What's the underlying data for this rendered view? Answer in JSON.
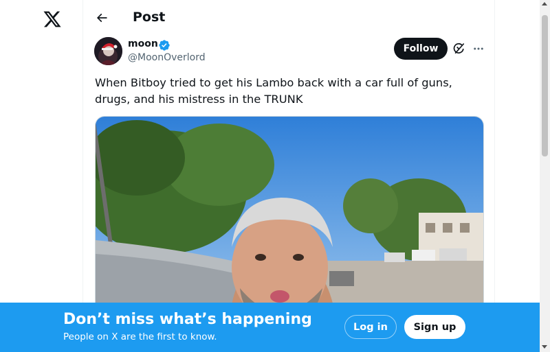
{
  "nav": {
    "logo_icon": "x-logo-icon"
  },
  "header": {
    "back_icon": "arrow-left-icon",
    "title": "Post"
  },
  "post": {
    "author": {
      "name": "moon",
      "handle": "@MoonOverlord",
      "verified": true,
      "verified_color": "#1d9bf0",
      "avatar_icon": "avatar-image"
    },
    "follow_label": "Follow",
    "grok_icon": "grok-icon",
    "more_icon": "more-options-icon",
    "text": "When Bitboy tried to get his Lambo back with a car full of guns, drugs, and his mistress in the TRUNK",
    "media_icon": "post-photo"
  },
  "banner": {
    "title": "Don’t miss what’s happening",
    "subtitle": "People on X are the first to know.",
    "login_label": "Log in",
    "signup_label": "Sign up",
    "background": "#1d9bf0"
  }
}
